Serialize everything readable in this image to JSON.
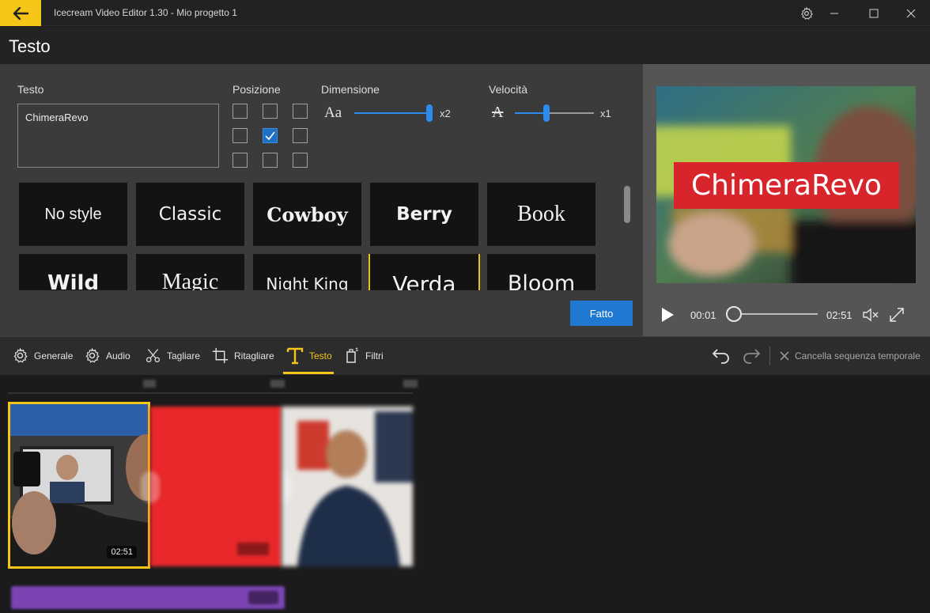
{
  "titlebar": {
    "title": "Icecream Video Editor 1.30 - Mio progetto 1",
    "icons": [
      "back-arrow-icon",
      "settings-gear-icon",
      "minimize-icon",
      "maximize-icon",
      "close-icon"
    ]
  },
  "header": {
    "title": "Testo"
  },
  "text_panel": {
    "text_label": "Testo",
    "text_value": "ChimeraRevo",
    "position_label": "Posizione",
    "position_selected": "center",
    "size_label": "Dimensione",
    "size_icon_text": "Aa",
    "size_value": "x2",
    "size_level": 1.0,
    "speed_label": "Velocità",
    "speed_icon_text": "A",
    "speed_value": "x1",
    "speed_level": 0.4
  },
  "styles": {
    "row1": [
      "No style",
      "Classic",
      "Cowboy",
      "Berry",
      "Book"
    ],
    "row2": [
      "Wild",
      "Magic",
      "Night King",
      "Verda",
      "Bloom"
    ],
    "selected": "Verda"
  },
  "done_button": "Fatto",
  "preview": {
    "overlay_text": "ChimeraRevo",
    "current_time": "00:01",
    "total_time": "02:51",
    "progress": 0.0
  },
  "toolbar": {
    "tabs": [
      {
        "label": "Generale",
        "icon": "gear-icon"
      },
      {
        "label": "Audio",
        "icon": "gear-icon"
      },
      {
        "label": "Tagliare",
        "icon": "scissors-icon"
      },
      {
        "label": "Ritagliare",
        "icon": "crop-icon"
      },
      {
        "label": "Testo",
        "icon": "text-t-icon"
      },
      {
        "label": "Filtri",
        "icon": "filters-icon"
      }
    ],
    "active_tab": "Testo",
    "clear_label": "Cancella sequenza temporale"
  },
  "timeline": {
    "clip1_duration": "02:51",
    "accent": "#f5c518"
  },
  "colors": {
    "accent_yellow": "#f5c518",
    "accent_blue": "#1f78d1",
    "overlay_red": "#d8242b"
  }
}
